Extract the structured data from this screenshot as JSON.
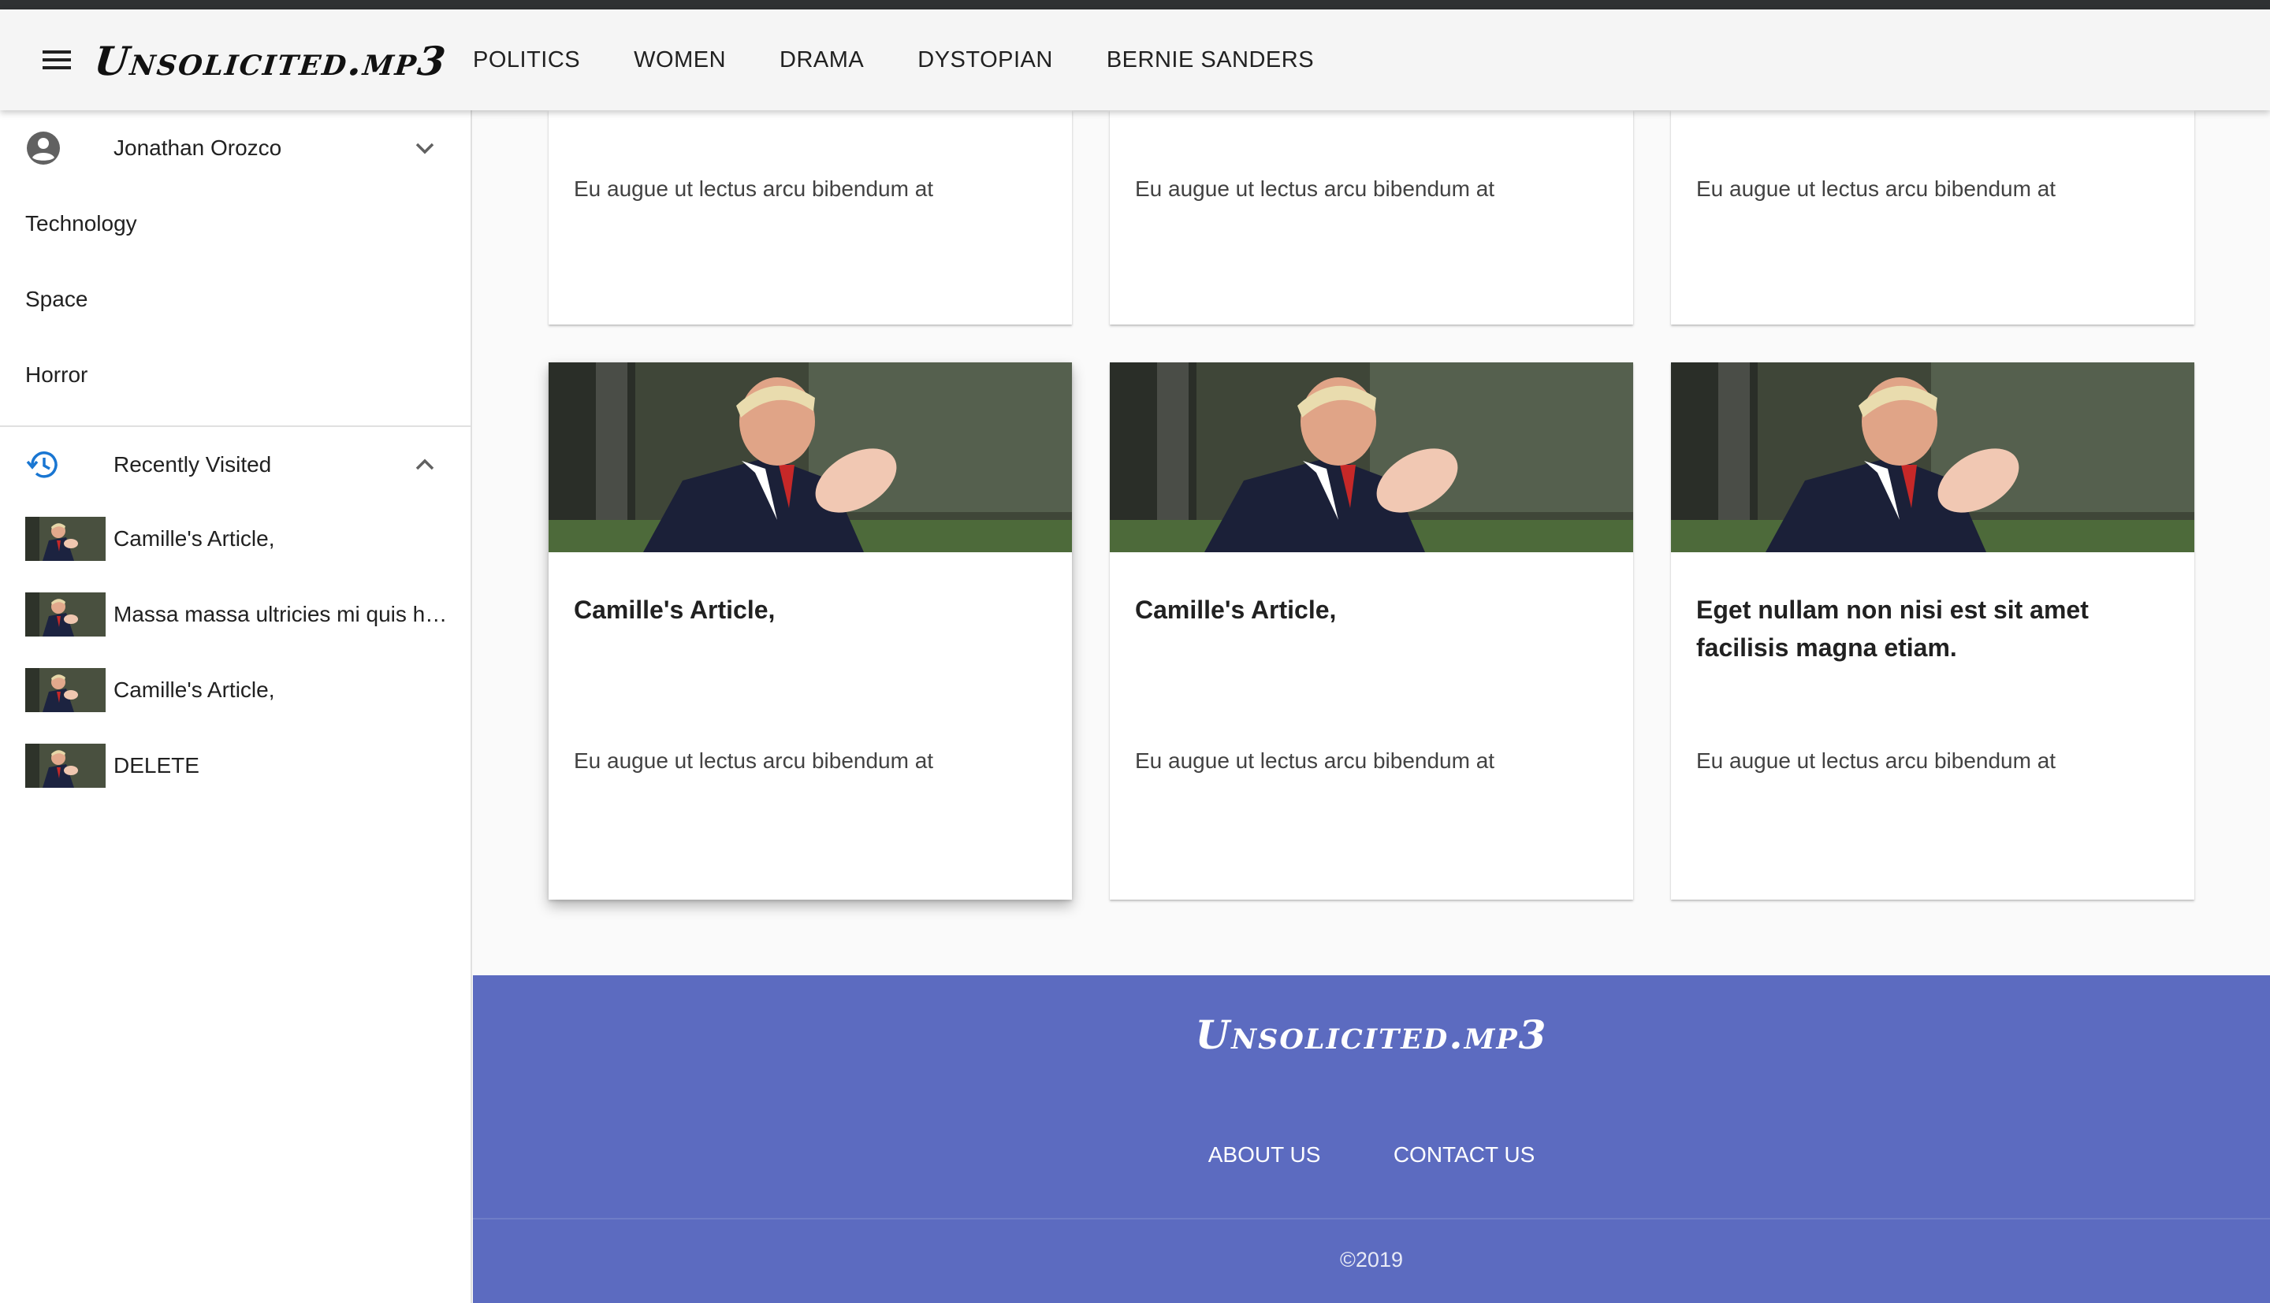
{
  "header": {
    "logo": "Unsolicited.mp3",
    "nav": [
      "POLITICS",
      "WOMEN",
      "DRAMA",
      "DYSTOPIAN",
      "BERNIE SANDERS"
    ]
  },
  "sidebar": {
    "user_name": "Jonathan Orozco",
    "categories": [
      "Technology",
      "Space",
      "Horror"
    ],
    "recent_title": "Recently Visited",
    "recent_items": [
      "Camille's Article,",
      "Massa massa ultricies mi quis h…",
      "Camille's Article,",
      "DELETE"
    ]
  },
  "cards_top": [
    {
      "text": "Eu augue ut lectus arcu bibendum at"
    },
    {
      "text": "Eu augue ut lectus arcu bibendum at"
    },
    {
      "text": "Eu augue ut lectus arcu bibendum at"
    }
  ],
  "cards_bottom": [
    {
      "title": "Camille's Article,",
      "text": "Eu augue ut lectus arcu bibendum at"
    },
    {
      "title": "Camille's Article,",
      "text": "Eu augue ut lectus arcu bibendum at"
    },
    {
      "title": "Eget nullam non nisi est sit amet facilisis magna etiam.",
      "text": "Eu augue ut lectus arcu bibendum at"
    }
  ],
  "footer": {
    "logo": "Unsolicited.mp3",
    "links": [
      "ABOUT US",
      "CONTACT US"
    ],
    "copyright": "©2019"
  },
  "colors": {
    "footer_bg": "#5c6bc0",
    "appbar_bg": "#f5f5f5",
    "accent_blue": "#1976d2"
  }
}
